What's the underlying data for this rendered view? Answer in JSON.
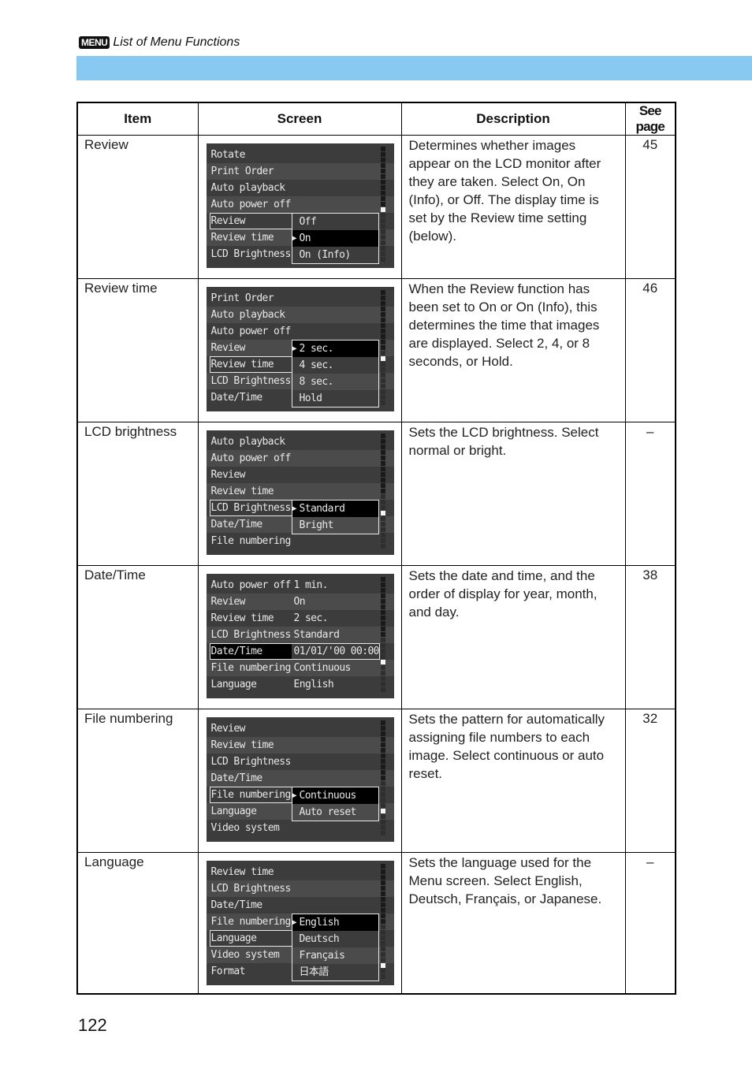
{
  "header": {
    "badge": "MENU",
    "title": "List of Menu Functions"
  },
  "table": {
    "columns": [
      "Item",
      "Screen",
      "Description",
      "See page"
    ],
    "rows": [
      {
        "item": "Review",
        "description": "Determines whether images appear on the LCD monitor after they are taken. Select On, On (Info), or Off. The display time is set by the Review time setting (below).",
        "page": "45",
        "screen": {
          "menu": [
            "Rotate",
            "Print Order",
            "Auto playback",
            "Auto power off",
            "Review",
            "Review time",
            "LCD Brightness"
          ],
          "selected_index": 4,
          "popup_start": 4,
          "popup": [
            "Off",
            "On",
            "On (Info)"
          ],
          "popup_active": 1
        }
      },
      {
        "item": "Review time",
        "description": "When the Review function has been set to On or On (Info), this determines the time that images are displayed. Select 2, 4, or 8 seconds, or Hold.",
        "page": "46",
        "screen": {
          "menu": [
            "Print Order",
            "Auto playback",
            "Auto power off",
            "Review",
            "Review time",
            "LCD Brightness",
            "Date/Time"
          ],
          "selected_index": 4,
          "popup_start": 3,
          "popup": [
            "2 sec.",
            "4 sec.",
            "8 sec.",
            "Hold"
          ],
          "popup_active": 0
        }
      },
      {
        "item": "LCD brightness",
        "description": "Sets the LCD brightness. Select normal or bright.",
        "page": "–",
        "screen": {
          "menu": [
            "Auto playback",
            "Auto power off",
            "Review",
            "Review time",
            "LCD Brightness",
            "Date/Time",
            "File numbering"
          ],
          "selected_index": 4,
          "popup_start": 4,
          "popup": [
            "Standard",
            "Bright"
          ],
          "popup_active": 0
        }
      },
      {
        "item": "Date/Time",
        "description": "Sets the date and time, and the order of display for year, month, and day.",
        "page": "38",
        "screen": {
          "menu": [
            "Auto power off",
            "Review",
            "Review time",
            "LCD Brightness",
            "Date/Time",
            "File numbering",
            "Language"
          ],
          "values": [
            "1 min.",
            "On",
            "2 sec.",
            "Standard",
            "01/01/'00 00:00",
            "Continuous",
            "English"
          ],
          "selected_index": 4
        }
      },
      {
        "item": "File numbering",
        "description": "Sets the pattern for automatically assigning file numbers to each image. Select continuous or auto reset.",
        "page": "32",
        "screen": {
          "menu": [
            "Review",
            "Review time",
            "LCD Brightness",
            "Date/Time",
            "File numbering",
            "Language",
            "Video system"
          ],
          "selected_index": 4,
          "popup_start": 4,
          "popup": [
            "Continuous",
            "Auto reset"
          ],
          "popup_active": 0
        }
      },
      {
        "item": "Language",
        "description": "Sets the language used for the Menu screen. Select English, Deutsch, Français, or Japanese.",
        "page": "–",
        "screen": {
          "menu": [
            "Review time",
            "LCD Brightness",
            "Date/Time",
            "File numbering",
            "Language",
            "Video system",
            "Format"
          ],
          "selected_index": 4,
          "popup_start": 3,
          "popup": [
            "English",
            "Deutsch",
            "Français",
            "日本語"
          ],
          "popup_active": 0
        }
      }
    ]
  },
  "footer": {
    "page_number": "122"
  }
}
